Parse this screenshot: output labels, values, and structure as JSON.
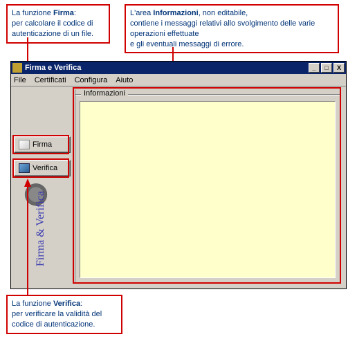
{
  "callouts": {
    "firma": {
      "pre": "La funzione ",
      "bold": "Firma",
      "post": ":\nper calcolare il codice di autenticazione di un file."
    },
    "info": {
      "pre": "L'area ",
      "bold": "Informazioni",
      "post": ", non editabile,\ncontiene i messaggi relativi allo svolgimento delle varie operazioni effettuate\ne gli eventuali messaggi di errore."
    },
    "verifica": {
      "pre": "La funzione ",
      "bold": "Verifica",
      "post": ":\nper verificare la validità del codice di autenticazione."
    }
  },
  "window": {
    "title": "Firma e Verifica",
    "menu": {
      "file": "File",
      "certificati": "Certificati",
      "configura": "Configura",
      "aiuto": "Aiuto"
    },
    "sidebar": {
      "firma_label": "Firma",
      "verifica_label": "Verifica",
      "vertical_label": "Firma & Verifica"
    },
    "info_legend": "Informazioni"
  },
  "winbtn": {
    "min": "_",
    "max": "□",
    "close": "X"
  }
}
